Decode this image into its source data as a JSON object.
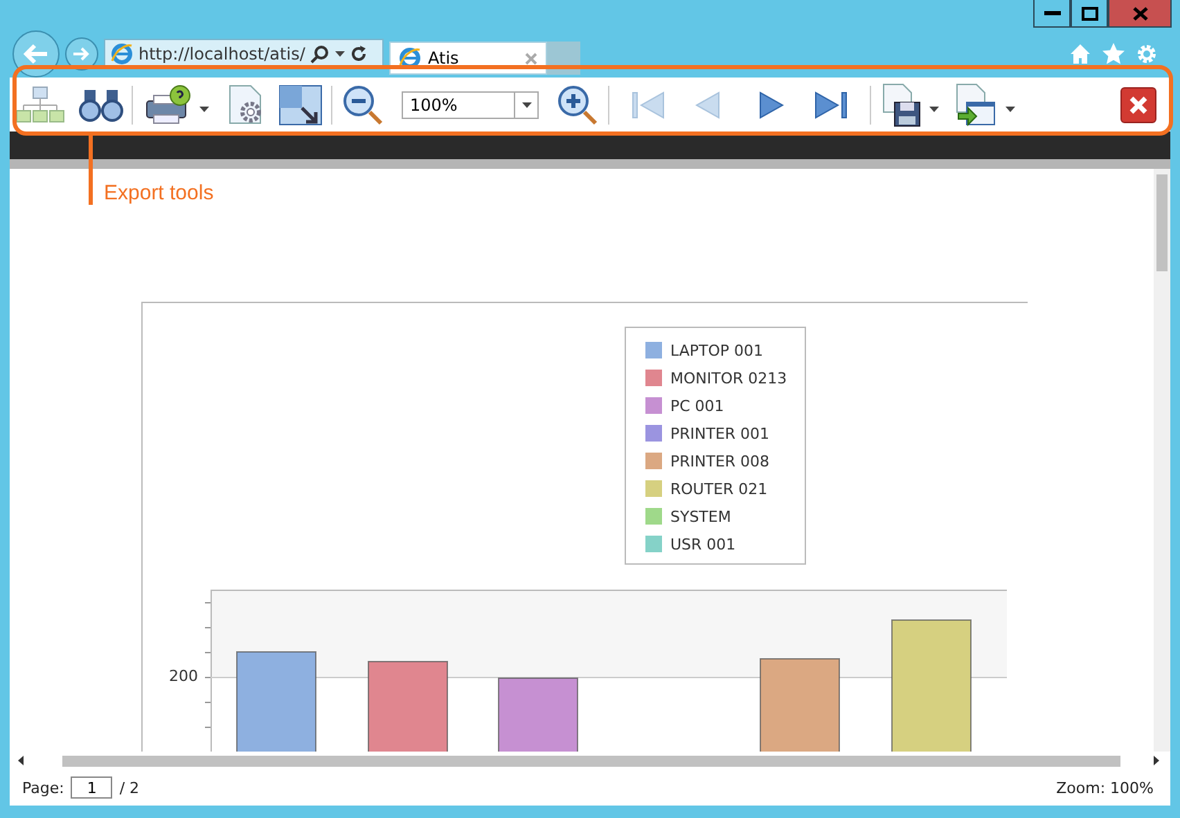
{
  "browser": {
    "address": "http://localhost/atis/",
    "tab": {
      "title": "Atis"
    }
  },
  "toolbar": {
    "zoom": "100%",
    "page_navigation": [
      {
        "kind": "first",
        "disabled": true
      },
      {
        "kind": "previous",
        "disabled": true
      },
      {
        "kind": "next",
        "disabled": false
      },
      {
        "kind": "last",
        "disabled": false
      }
    ]
  },
  "annotation": {
    "label": "Export tools"
  },
  "chart": {
    "legend": [
      {
        "label": "LAPTOP 001",
        "color": "#8eb0e0"
      },
      {
        "label": "MONITOR 0213",
        "color": "#e0868f"
      },
      {
        "label": "PC 001",
        "color": "#c690d2"
      },
      {
        "label": "PRINTER 001",
        "color": "#9b94e0"
      },
      {
        "label": "PRINTER 008",
        "color": "#dba882"
      },
      {
        "label": "ROUTER 021",
        "color": "#d6d080"
      },
      {
        "label": "SYSTEM",
        "color": "#9fd98a"
      },
      {
        "label": "USR 001",
        "color": "#85d2c8"
      }
    ],
    "y_tick": "200"
  },
  "status_bar": {
    "page_label": "Page:",
    "page": "1",
    "page_total": "/ 2",
    "zoom": "Zoom: 100%"
  }
}
